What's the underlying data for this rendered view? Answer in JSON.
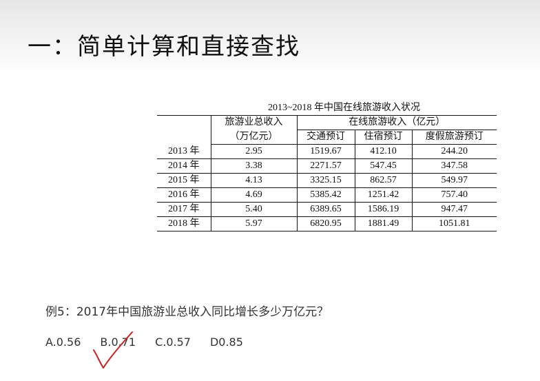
{
  "slide": {
    "title": "一：简单计算和直接查找"
  },
  "table": {
    "caption": "2013~2018 年中国在线旅游收入状况",
    "header": {
      "total_label": "旅游业总收入",
      "total_unit": "（万亿元）",
      "online_label": "在线旅游收入（亿元）",
      "sub_transport": "交通预订",
      "sub_lodging": "住宿预订",
      "sub_vacation": "度假旅游预订"
    },
    "rows": [
      {
        "year": "2013 年",
        "total": "2.95",
        "transport": "1519.67",
        "lodging": "412.10",
        "vacation": "244.20"
      },
      {
        "year": "2014 年",
        "total": "3.38",
        "transport": "2271.57",
        "lodging": "547.45",
        "vacation": "347.58"
      },
      {
        "year": "2015 年",
        "total": "4.13",
        "transport": "3325.15",
        "lodging": "862.57",
        "vacation": "549.97"
      },
      {
        "year": "2016 年",
        "total": "4.69",
        "transport": "5385.42",
        "lodging": "1251.42",
        "vacation": "757.40"
      },
      {
        "year": "2017 年",
        "total": "5.40",
        "transport": "6389.65",
        "lodging": "1586.19",
        "vacation": "947.47"
      },
      {
        "year": "2018 年",
        "total": "5.97",
        "transport": "6820.95",
        "lodging": "1881.49",
        "vacation": "1051.81"
      }
    ]
  },
  "question": {
    "text": "例5：2017年中国旅游业总收入同比增长多少万亿元？",
    "options": [
      "A.0.56",
      "B.0.71",
      "C.0.57",
      "D0.85"
    ],
    "check_color": "#cc1f1f"
  }
}
